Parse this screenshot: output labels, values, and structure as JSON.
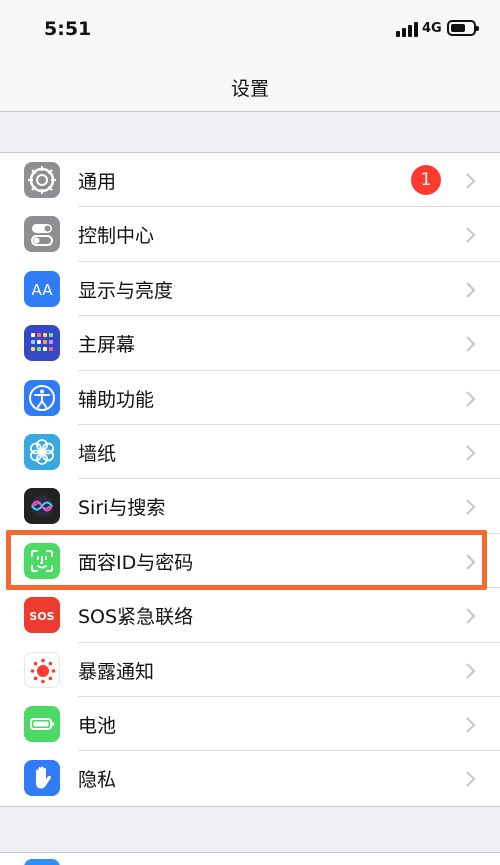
{
  "status": {
    "time": "5:51",
    "network": "4G"
  },
  "nav": {
    "title": "设置"
  },
  "badge": {
    "general_count": "1"
  },
  "settings": [
    {
      "label": "通用",
      "icon": "gear-icon",
      "color": "#8e8e93"
    },
    {
      "label": "控制中心",
      "icon": "toggles-icon",
      "color": "#8e8e93"
    },
    {
      "label": "显示与亮度",
      "icon": "text-size-icon",
      "color": "#2f7cf6"
    },
    {
      "label": "主屏幕",
      "icon": "home-grid-icon",
      "color": "#3548c7"
    },
    {
      "label": "辅助功能",
      "icon": "accessibility-icon",
      "color": "#2f7cf6"
    },
    {
      "label": "墙纸",
      "icon": "flower-icon",
      "color": "#38a8e0"
    },
    {
      "label": "Siri与搜索",
      "icon": "siri-icon",
      "color": "#222222"
    },
    {
      "label": "面容ID与密码",
      "icon": "face-id-icon",
      "color": "#4cd964"
    },
    {
      "label": "SOS紧急联络",
      "icon": "sos-icon",
      "color": "#ef3b2f"
    },
    {
      "label": "暴露通知",
      "icon": "exposure-icon",
      "color": "#ffffff"
    },
    {
      "label": "电池",
      "icon": "battery-icon",
      "color": "#4cd964"
    },
    {
      "label": "隐私",
      "icon": "hand-icon",
      "color": "#2f7cf6"
    }
  ],
  "highlight_color": "#f26a32"
}
